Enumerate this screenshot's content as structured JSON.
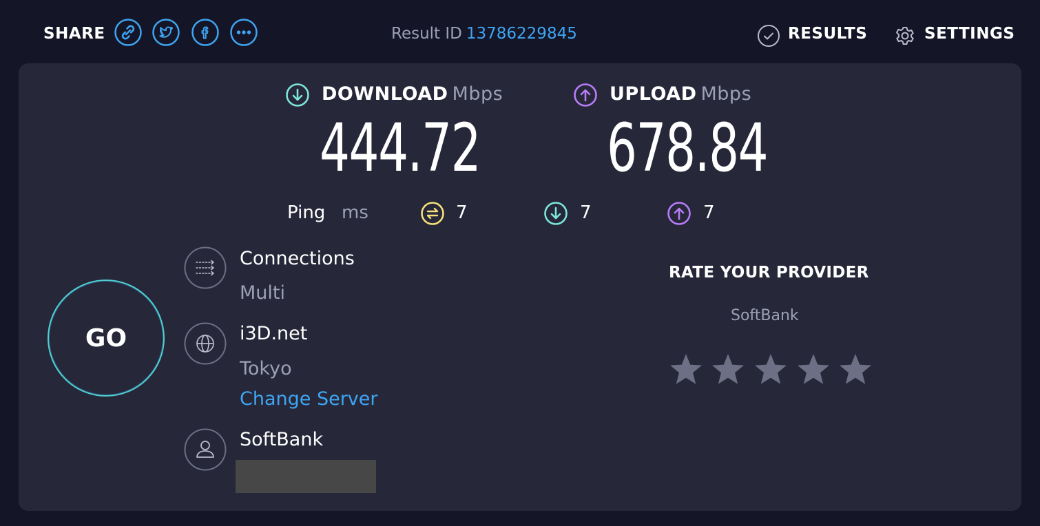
{
  "header": {
    "share_label": "SHARE",
    "share_icons": [
      "link-icon",
      "twitter-icon",
      "facebook-icon",
      "more-icon"
    ],
    "result_id_label": "Result ID",
    "result_id_value": "13786229845",
    "results_label": "RESULTS",
    "settings_label": "SETTINGS"
  },
  "download": {
    "label": "DOWNLOAD",
    "unit": "Mbps",
    "value": "444.72"
  },
  "upload": {
    "label": "UPLOAD",
    "unit": "Mbps",
    "value": "678.84"
  },
  "ping": {
    "label": "Ping",
    "unit": "ms",
    "idle": "7",
    "download": "7",
    "upload": "7"
  },
  "go_label": "GO",
  "connections": {
    "title": "Connections",
    "value": "Multi"
  },
  "server": {
    "title": "i3D.net",
    "location": "Tokyo",
    "change_label": "Change Server"
  },
  "provider": {
    "title": "SoftBank"
  },
  "rate": {
    "title": "RATE YOUR PROVIDER",
    "provider": "SoftBank",
    "stars": 5
  },
  "colors": {
    "background": "#141526",
    "panel": "#262739",
    "accent_blue": "#3fa5f2",
    "download": "#7ee6d9",
    "upload": "#b87cf7",
    "ping": "#f3e07a",
    "muted": "#9da0b5",
    "star": "#6d6f84"
  }
}
